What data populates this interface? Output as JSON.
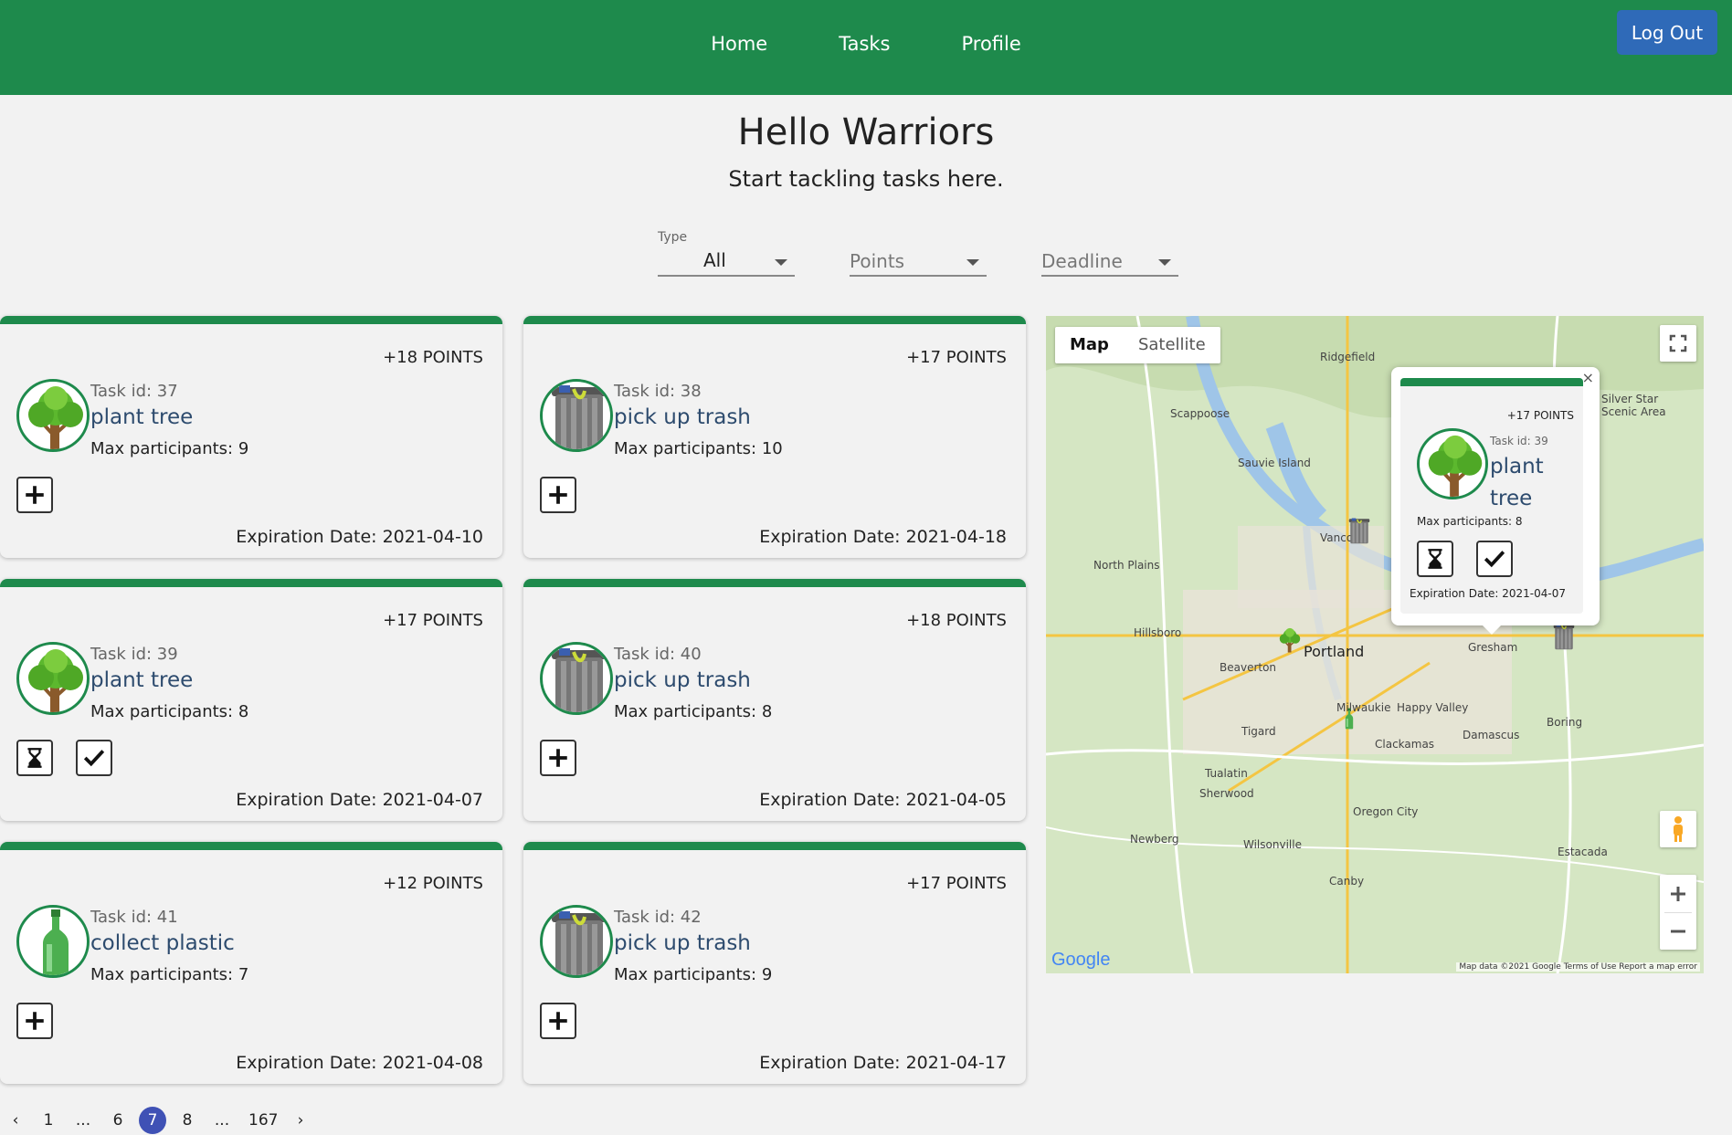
{
  "nav": {
    "home": "Home",
    "tasks": "Tasks",
    "profile": "Profile",
    "logout": "Log Out"
  },
  "hero": {
    "title": "Hello Warriors",
    "subtitle": "Start tackling tasks here."
  },
  "filters": {
    "type_label": "Type",
    "type_value": "All",
    "points_placeholder": "Points",
    "deadline_placeholder": "Deadline"
  },
  "cards": [
    {
      "points": "+18 POINTS",
      "task_id": "Task id: 37",
      "name": "plant tree",
      "max": "Max participants: 9",
      "expiration": "Expiration Date: 2021-04-10",
      "icon": "tree-icon"
    },
    {
      "points": "+17 POINTS",
      "task_id": "Task id: 38",
      "name": "pick up trash",
      "max": "Max participants: 10",
      "expiration": "Expiration Date: 2021-04-18",
      "icon": "trash-can-icon"
    },
    {
      "points": "+17 POINTS",
      "task_id": "Task id: 39",
      "name": "plant tree",
      "max": "Max participants: 8",
      "expiration": "Expiration Date: 2021-04-07",
      "icon": "tree-icon"
    },
    {
      "points": "+18 POINTS",
      "task_id": "Task id: 40",
      "name": "pick up trash",
      "max": "Max participants: 8",
      "expiration": "Expiration Date: 2021-04-05",
      "icon": "trash-can-icon"
    },
    {
      "points": "+12 POINTS",
      "task_id": "Task id: 41",
      "name": "collect plastic",
      "max": "Max participants: 7",
      "expiration": "Expiration Date: 2021-04-08",
      "icon": "bottle-icon"
    },
    {
      "points": "+17 POINTS",
      "task_id": "Task id: 42",
      "name": "pick up trash",
      "max": "Max participants: 9",
      "expiration": "Expiration Date: 2021-04-17",
      "icon": "trash-can-icon"
    }
  ],
  "map": {
    "tab_map": "Map",
    "tab_satellite": "Satellite",
    "cities": {
      "portland": "Portland",
      "beaverton": "Beaverton",
      "hillsboro": "Hillsboro",
      "gresham": "Gresham",
      "tigard": "Tigard",
      "vancouver": "Vancou",
      "milwaukie": "Milwaukie",
      "scappoose": "Scappoose",
      "sauvie": "Sauvie Island",
      "northplains": "North Plains",
      "oregoncity": "Oregon City",
      "tualatin": "Tualatin",
      "sherwood": "Sherwood",
      "happyvalley": "Happy Valley",
      "damascus": "Damascus",
      "clackamas": "Clackamas",
      "canby": "Canby",
      "wilsonville": "Wilsonville",
      "newberg": "Newberg",
      "ridgefield": "Ridgefield",
      "boring": "Boring",
      "estacada": "Estacada",
      "silverstar": "Silver Star Scenic Area"
    },
    "google": "Google",
    "attribution": "Map data ©2021 Google   Terms of Use   Report a map error",
    "popup": {
      "points": "+17 POINTS",
      "task_id": "Task id: 39",
      "name": "plant tree",
      "max": "Max participants: 8",
      "expiration": "Expiration Date: 2021-04-07",
      "close": "×"
    }
  },
  "pagination": {
    "prev": "‹",
    "pages": [
      "1",
      "...",
      "6",
      "7",
      "8",
      "...",
      "167"
    ],
    "current": "7",
    "next": "›"
  },
  "colors": {
    "brand_green": "#1e8a4c",
    "logout_blue": "#2f6ab8",
    "pager_active": "#3f51b5",
    "task_name": "#2d4b6e"
  }
}
